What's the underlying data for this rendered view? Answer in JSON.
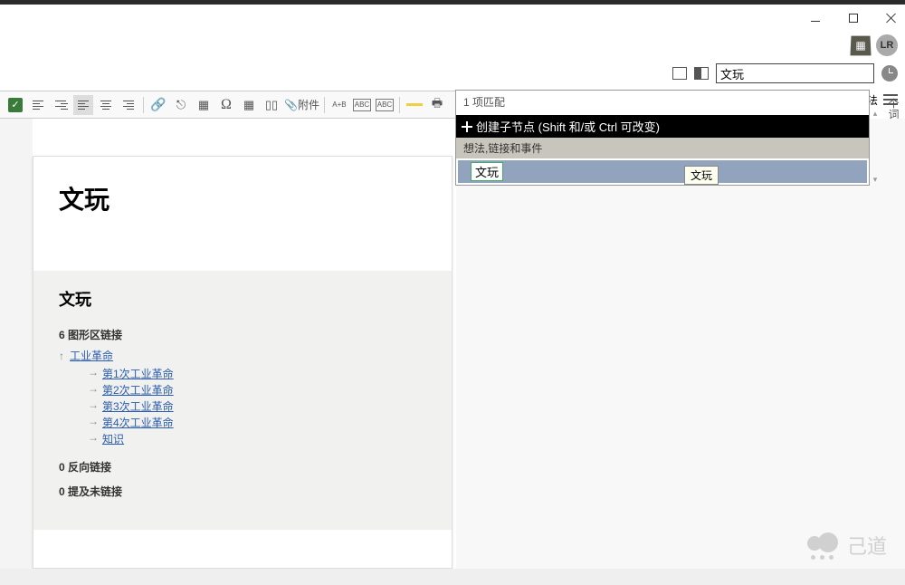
{
  "window": {
    "avatar_initials": "LR"
  },
  "search": {
    "value": "文玩"
  },
  "restrict": {
    "label": "限制下级想法"
  },
  "side_label": "个词",
  "dropdown": {
    "match_count": "1 项匹配",
    "create_label": "创建子节点 (Shift 和/或 Ctrl 可改变)",
    "section_label": "想法,链接和事件",
    "result": "文玩"
  },
  "tooltip": "文玩",
  "toolbar": {
    "attach_label": "附件",
    "ab": "A+B",
    "abc1": "ABC",
    "abc2": "ABC"
  },
  "page": {
    "title": "文玩",
    "section_title": "文玩",
    "graph_links_header": "6 图形区链接",
    "parent_link": "工业革命",
    "children": [
      "第1次工业革命",
      "第2次工业革命",
      "第3次工业革命",
      "第4次工业革命",
      "知识"
    ],
    "backlinks_header": "0 反向链接",
    "unlinked_header": "0 提及未链接"
  },
  "watermark": {
    "text": "己道"
  }
}
